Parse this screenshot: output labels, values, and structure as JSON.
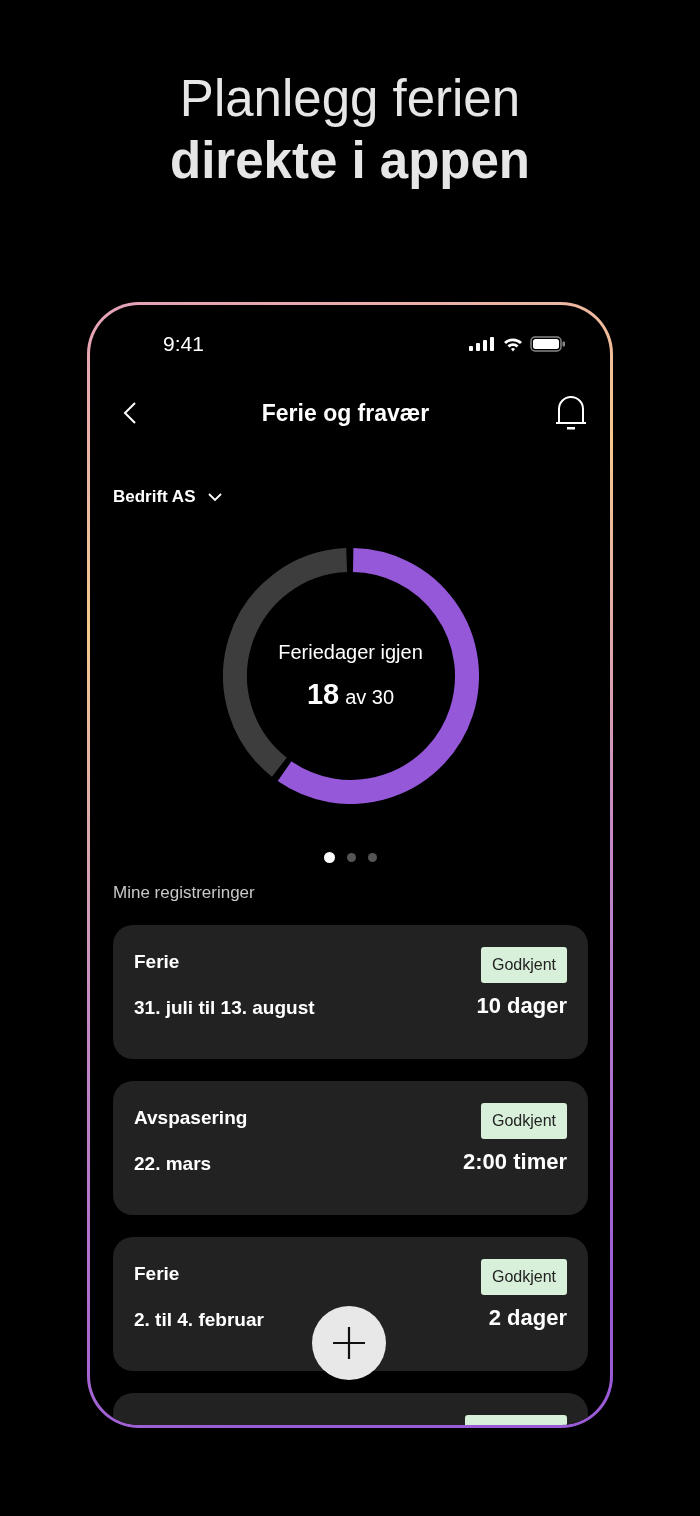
{
  "headline": {
    "line_1": "Planlegg ferien",
    "line_2": "direkte i appen"
  },
  "status_bar": {
    "time": "9:41"
  },
  "header": {
    "title": "Ferie og fravær"
  },
  "company_selector": {
    "label": "Bedrift AS"
  },
  "vacation_ring": {
    "label": "Feriedager igjen",
    "remaining": "18",
    "of_total": "av 30"
  },
  "pager": [
    {
      "selected": true
    },
    {
      "selected": false
    },
    {
      "selected": false
    }
  ],
  "section_title": "Mine registreringer",
  "registrations": [
    {
      "type": "Ferie",
      "dates": "31. juli til 13. august",
      "status": "Godkjent",
      "amount": "10 dager"
    },
    {
      "type": "Avspasering",
      "dates": "22. mars",
      "status": "Godkjent",
      "amount": "2:00 timer"
    },
    {
      "type": "Ferie",
      "dates": "2. til 4. februar",
      "status": "Godkjent",
      "amount": "2 dager"
    }
  ]
}
